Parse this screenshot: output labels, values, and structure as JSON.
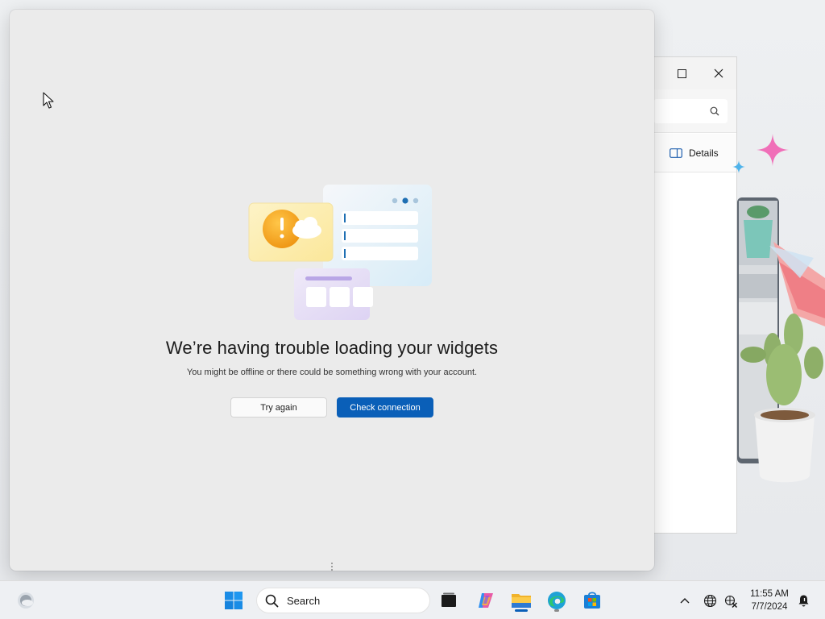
{
  "explorer": {
    "details_label": "Details"
  },
  "widgets": {
    "error_title": "We’re having trouble loading your widgets",
    "error_subtitle": "You might be offline or there could be something wrong with your account.",
    "try_again_label": "Try again",
    "check_connection_label": "Check connection"
  },
  "taskbar": {
    "search_placeholder": "Search",
    "apps": [
      "widgets-icon",
      "start-icon",
      "search-icon",
      "task-view-icon",
      "copilot-icon",
      "file-explorer-icon",
      "edge-icon",
      "store-icon"
    ],
    "tray": [
      "chevron-up-icon",
      "globe-icon",
      "network-off-icon",
      "notification-icon"
    ],
    "time": "11:55 AM",
    "date": "7/7/2024"
  },
  "colors": {
    "accent": "#0a5fb8",
    "panel_bg": "#ebebeb",
    "warning_orange": "#f2a01e"
  }
}
